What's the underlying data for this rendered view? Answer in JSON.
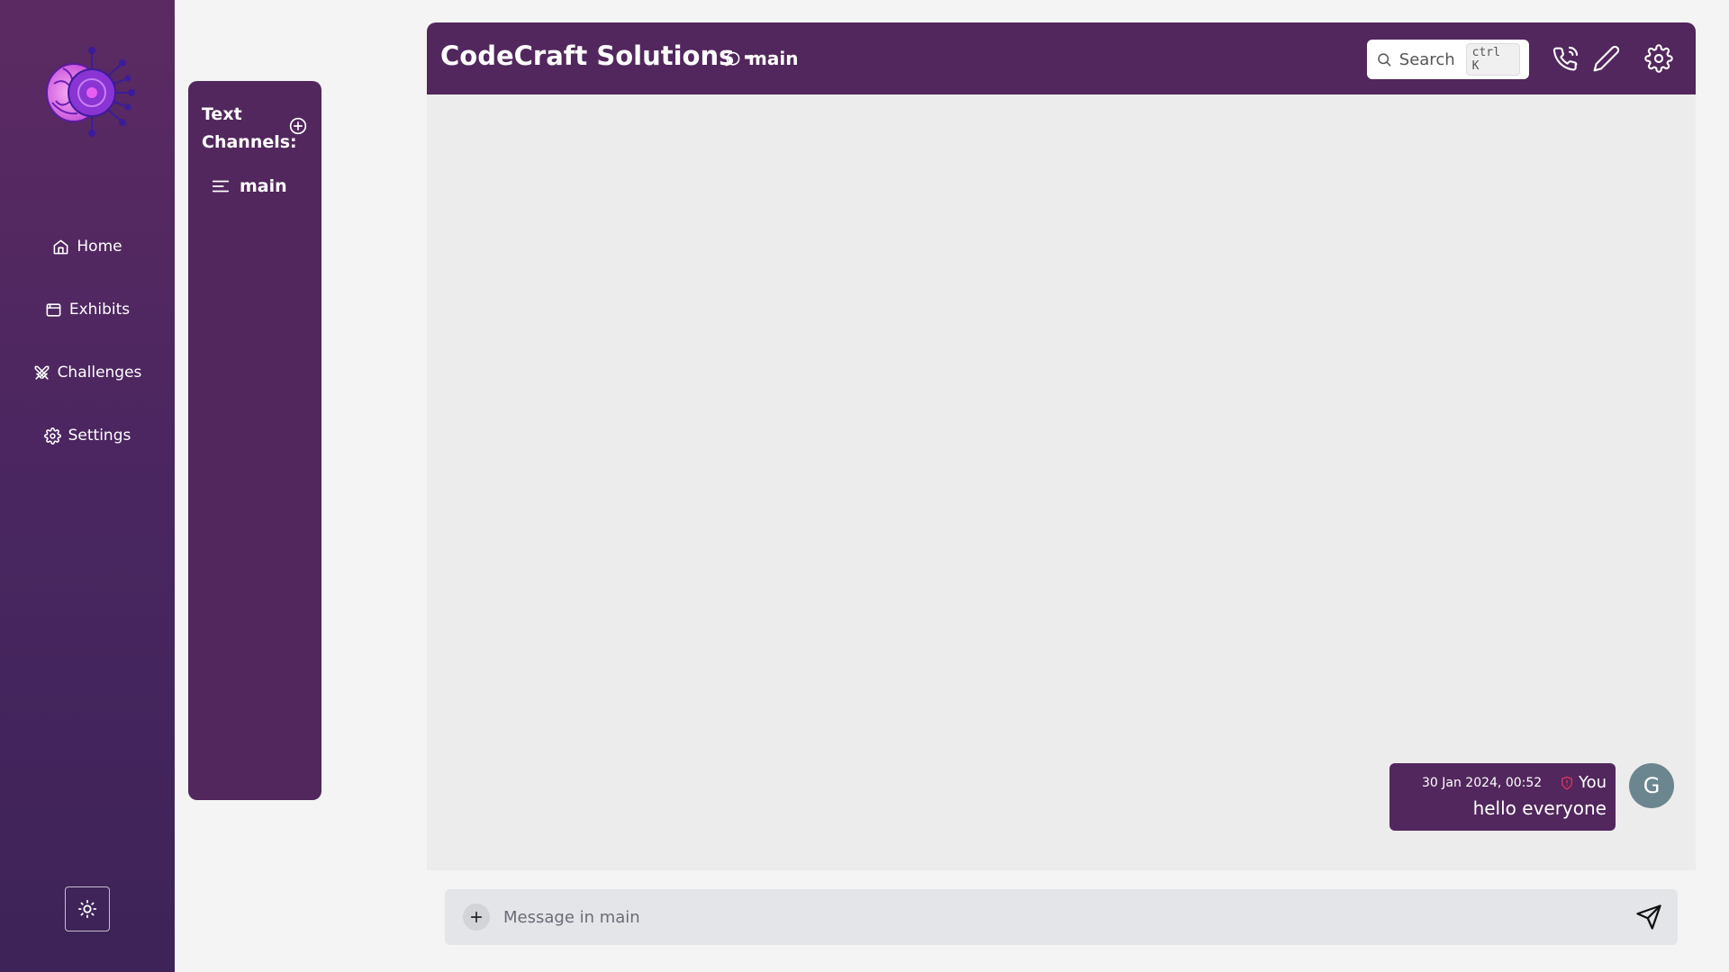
{
  "colors": {
    "nav_gradient_top": "#5c2a62",
    "nav_gradient_bottom": "#3d2358",
    "panel": "#52275d",
    "chat_bg": "#ececec",
    "composer_bg": "#e4e5e9",
    "avatar_bg": "#6b868f",
    "shield_icon": "#e0345c"
  },
  "nav": {
    "logo_icon": "brain-circuit-logo",
    "items": [
      {
        "label": "Home",
        "icon": "home-icon"
      },
      {
        "label": "Exhibits",
        "icon": "browser-window-icon"
      },
      {
        "label": "Challenges",
        "icon": "crossed-swords-icon"
      },
      {
        "label": "Settings",
        "icon": "gear-icon"
      }
    ],
    "theme_toggle_icon": "sun-icon"
  },
  "channels": {
    "heading": "Text Channels:",
    "add_icon": "plus-circle-icon",
    "items": [
      {
        "label": "main",
        "icon": "align-left-icon"
      }
    ]
  },
  "header": {
    "title": "CodeCraft Solutions -",
    "channel": "main",
    "channel_icon": "chat-bubble-icon",
    "search": {
      "label": "Search",
      "shortcut": "ctrl K"
    },
    "actions": [
      {
        "icon": "phone-call-icon"
      },
      {
        "icon": "pencil-icon"
      },
      {
        "icon": "gear-icon"
      }
    ]
  },
  "messages": [
    {
      "timestamp": "30 Jan 2024, 00:52",
      "author": "You",
      "author_icon": "shield-icon",
      "text": "hello everyone",
      "avatar_letter": "G"
    }
  ],
  "composer": {
    "placeholder": "Message in main",
    "attach_icon": "plus-icon",
    "send_icon": "send-icon"
  }
}
